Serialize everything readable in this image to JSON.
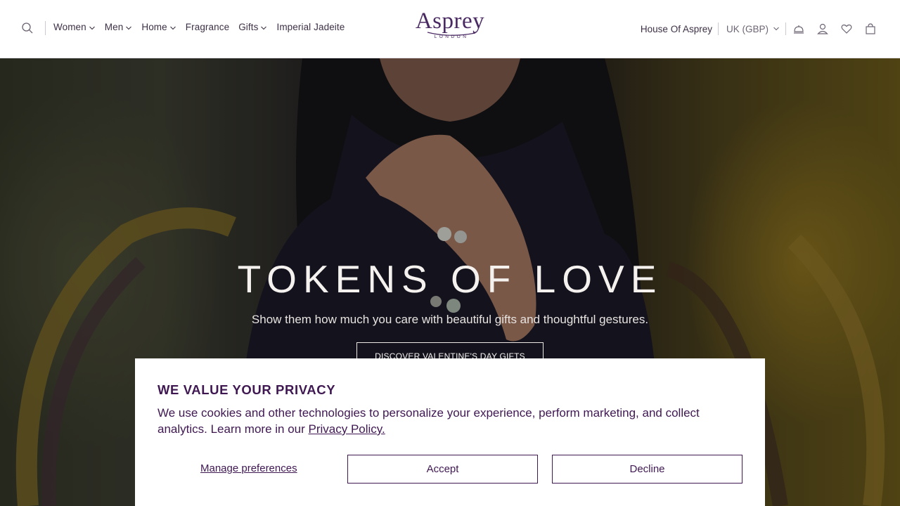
{
  "header": {
    "nav": [
      {
        "label": "Women",
        "has_dropdown": true
      },
      {
        "label": "Men",
        "has_dropdown": true
      },
      {
        "label": "Home",
        "has_dropdown": true
      },
      {
        "label": "Fragrance",
        "has_dropdown": false
      },
      {
        "label": "Gifts",
        "has_dropdown": true
      },
      {
        "label": "Imperial Jadeite",
        "has_dropdown": false
      }
    ],
    "logo": {
      "word": "Asprey",
      "sub": "LONDON"
    },
    "house_link": "House Of Asprey",
    "currency": "UK (GBP)",
    "icons": [
      "search-icon",
      "concierge-bell-icon",
      "account-icon",
      "wishlist-heart-icon",
      "bag-icon"
    ]
  },
  "hero": {
    "title": "TOKENS OF LOVE",
    "subtitle": "Show them how much you care with beautiful gifts and thoughtful gestures.",
    "cta": "DISCOVER VALENTINE'S DAY GIFTS"
  },
  "cookie": {
    "title": "WE VALUE YOUR PRIVACY",
    "text": "We use cookies and other technologies to personalize your experience, perform marketing, and collect analytics. Learn more in our ",
    "link": "Privacy Policy.",
    "manage": "Manage preferences",
    "accept": "Accept",
    "decline": "Decline"
  },
  "colors": {
    "brand": "#4a2a63",
    "banner_text": "#3f1852"
  }
}
